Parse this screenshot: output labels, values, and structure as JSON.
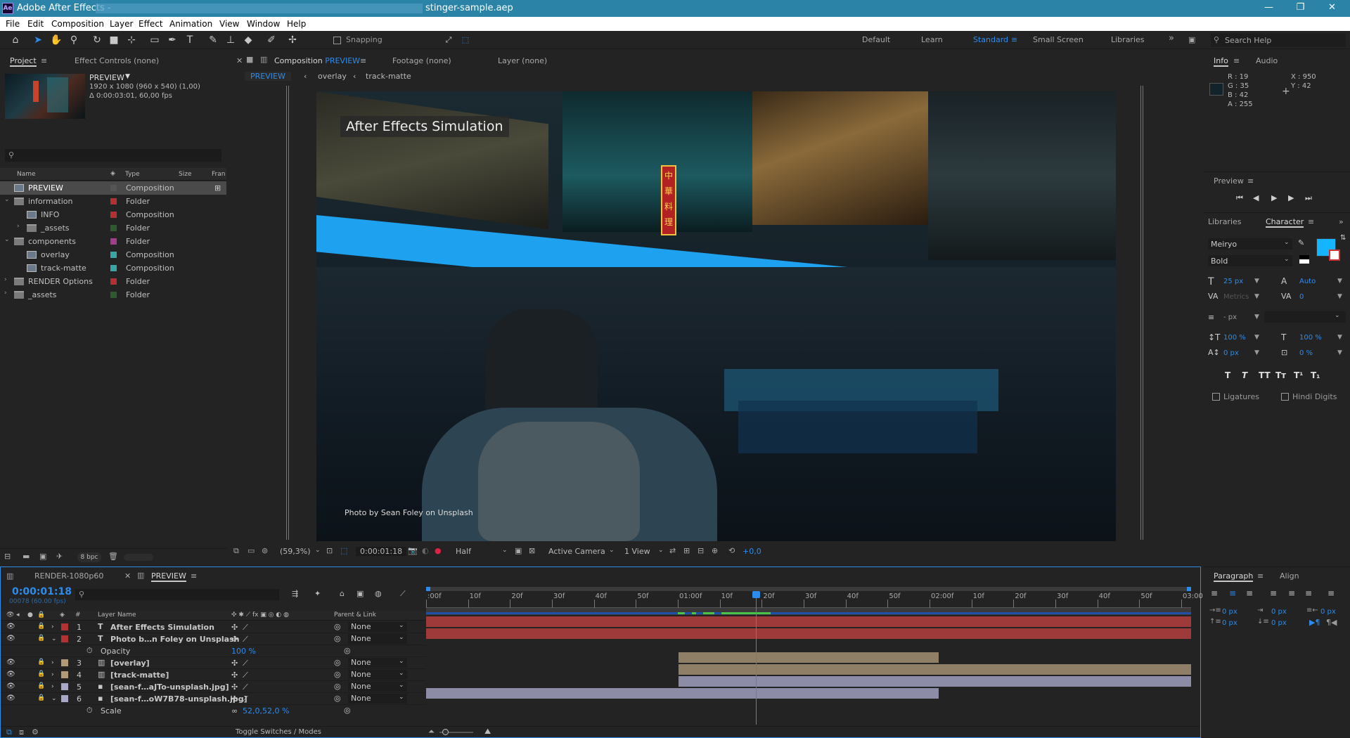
{
  "window": {
    "title": "Adobe After Effects -",
    "title_file": "stinger-sample.aep",
    "min_glyph": "—",
    "max_glyph": "❐",
    "close_glyph": "✕"
  },
  "menu": [
    "File",
    "Edit",
    "Composition",
    "Layer",
    "Effect",
    "Animation",
    "View",
    "Window",
    "Help"
  ],
  "toolbar": {
    "snapping_label": "Snapping",
    "workspaces": [
      "Default",
      "Learn",
      "Standard",
      "Small Screen",
      "Libraries"
    ],
    "active_workspace": "Standard",
    "search_placeholder": "Search Help"
  },
  "project_panel": {
    "tab_project": "Project",
    "tab_effect_controls": "Effect Controls (none)",
    "preview_name": "PREVIEW",
    "preview_dims": "1920 x 1080  (960 x 540) (1,00)",
    "preview_dur": "Δ 0:00:03:01, 60,00 fps",
    "columns": {
      "name": "Name",
      "type": "Type",
      "size": "Size",
      "frame": "Fran"
    },
    "items": [
      {
        "name": "PREVIEW",
        "type": "Composition",
        "color": "#555555",
        "kind": "comp",
        "indent": 0,
        "selected": true
      },
      {
        "name": "information",
        "type": "Folder",
        "color": "#b03232",
        "kind": "folder",
        "indent": 0,
        "open": true
      },
      {
        "name": "INFO",
        "type": "Composition",
        "color": "#b03232",
        "kind": "comp",
        "indent": 1
      },
      {
        "name": "_assets",
        "type": "Folder",
        "color": "#2f5a2f",
        "kind": "folder",
        "indent": 1,
        "closed": true
      },
      {
        "name": "components",
        "type": "Folder",
        "color": "#a23d8e",
        "kind": "folder",
        "indent": 0,
        "open": true
      },
      {
        "name": "overlay",
        "type": "Composition",
        "color": "#3aa5a5",
        "kind": "comp",
        "indent": 1
      },
      {
        "name": "track-matte",
        "type": "Composition",
        "color": "#3aa5a5",
        "kind": "comp",
        "indent": 1
      },
      {
        "name": "RENDER Options",
        "type": "Folder",
        "color": "#b03232",
        "kind": "folder",
        "indent": 0,
        "closed": true
      },
      {
        "name": "_assets",
        "type": "Folder",
        "color": "#2f5a2f",
        "kind": "folder",
        "indent": 0,
        "closed": true
      }
    ],
    "bpc": "8 bpc"
  },
  "composition_panel": {
    "tab_comp_prefix": "Composition",
    "tab_comp_name": "PREVIEW",
    "tab_footage": "Footage (none)",
    "tab_layer": "Layer (none)",
    "breadcrumbs": [
      "PREVIEW",
      "overlay",
      "track-matte"
    ],
    "overlay_title": "After Effects Simulation",
    "photo_credit": "Photo by Sean Foley on Unsplash",
    "neon_sign": "中華料理",
    "zoom": "(59,3%)",
    "timecode": "0:00:01:18",
    "resolution": "Half",
    "camera": "Active Camera",
    "views": "1 View",
    "exposure": "+0,0"
  },
  "info_panel": {
    "tab_info": "Info",
    "tab_audio": "Audio",
    "r": "R : 19",
    "g": "G : 35",
    "b": "B : 42",
    "a": "A : 255",
    "x": "X : 950",
    "y": "Y : 42",
    "swatch": "#13232a"
  },
  "preview_panel": {
    "title": "Preview"
  },
  "character_panel": {
    "tab_libraries": "Libraries",
    "tab_character": "Character",
    "font": "Meiryo",
    "style": "Bold",
    "size": "25 px",
    "leading": "Auto",
    "kerning": "Metrics",
    "tracking": "0",
    "stroke": "- px",
    "vscale": "100 %",
    "hscale": "100 %",
    "baseline": "0 px",
    "tsume": "0 %",
    "fill_color": "#14b4ff",
    "styles": [
      "T",
      "T",
      "TT",
      "Tт",
      "T¹",
      "T₁"
    ],
    "ligatures": "Ligatures",
    "hindi": "Hindi Digits"
  },
  "paragraph_panel": {
    "tab_paragraph": "Paragraph",
    "tab_align": "Align",
    "indent_left": "0 px",
    "indent_right": "0 px",
    "indent_first": "0 px",
    "space_before": "0 px",
    "space_after": "0 px"
  },
  "timeline": {
    "tab_render": "RENDER-1080p60",
    "tab_preview": "PREVIEW",
    "timecode": "0:00:01:18",
    "frame_info": "00078 (60.00 fps)",
    "col_layer_name": "Layer Name",
    "col_parent": "Parent & Link",
    "ruler_labels": [
      ":00f",
      "10f",
      "20f",
      "30f",
      "40f",
      "50f",
      "01:00f",
      "10f",
      "20f",
      "30f",
      "40f",
      "50f",
      "02:00f",
      "10f",
      "20f",
      "30f",
      "40f",
      "50f",
      "03:00"
    ],
    "playhead_fraction": 0.4309,
    "layers": [
      {
        "num": "1",
        "name": "After Effects Simulation",
        "type": "text",
        "color": "#b03232",
        "parent": "None",
        "start": 0.0,
        "end": 1.0,
        "bar": "#9e3a3a"
      },
      {
        "num": "2",
        "name": "Photo b…n Foley on Unsplash",
        "type": "text",
        "color": "#b03232",
        "parent": "None",
        "start": 0.0,
        "end": 1.0,
        "bar": "#9e3a3a",
        "open": true
      },
      {
        "num": "3",
        "name": "[overlay]",
        "type": "comp",
        "color": "#b39a77",
        "parent": "None",
        "start": 0.33,
        "end": 0.67,
        "bar": "#8f7f66"
      },
      {
        "num": "4",
        "name": "[track-matte]",
        "type": "comp",
        "color": "#b39a77",
        "parent": "None",
        "start": 0.33,
        "end": 1.0,
        "bar": "#8f7f66"
      },
      {
        "num": "5",
        "name": "[sean-f…aJTo-unsplash.jpg]",
        "type": "image",
        "color": "#a7a7c7",
        "parent": "None",
        "start": 0.33,
        "end": 1.0,
        "bar": "#8c8ca6"
      },
      {
        "num": "6",
        "name": "[sean-f…oW7B78-unsplash.jpg]",
        "type": "image",
        "color": "#a7a7c7",
        "parent": "None",
        "start": 0.0,
        "end": 0.67,
        "bar": "#8c8ca6",
        "open": true
      }
    ],
    "opacity_label": "Opacity",
    "opacity_value": "100 %",
    "scale_label": "Scale",
    "scale_value": "52,0,52,0 %",
    "toggle_label": "Toggle Switches / Modes"
  }
}
